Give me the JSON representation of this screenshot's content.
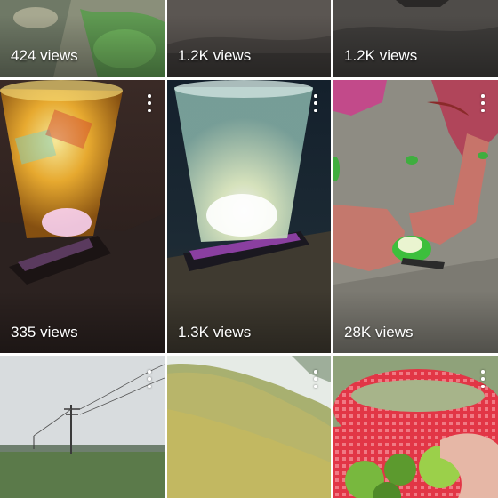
{
  "grid": {
    "rows": [
      {
        "tiles": [
          {
            "views": "424 views",
            "subject": "grass-ground"
          },
          {
            "views": "1.2K views",
            "subject": "dark-ground"
          },
          {
            "views": "1.2K views",
            "subject": "dark-ground-2"
          }
        ]
      },
      {
        "tiles": [
          {
            "views": "335 views",
            "subject": "glowing-orange-drink"
          },
          {
            "views": "1.3K views",
            "subject": "glowing-white-drink"
          },
          {
            "views": "28K views",
            "subject": "cutting-lime"
          }
        ]
      },
      {
        "tiles": [
          {
            "views": "",
            "subject": "field-power-pole"
          },
          {
            "views": "",
            "subject": "crop-field"
          },
          {
            "views": "",
            "subject": "limes-in-red-basket"
          }
        ]
      }
    ],
    "menu_icon": "more-vert-icon"
  }
}
